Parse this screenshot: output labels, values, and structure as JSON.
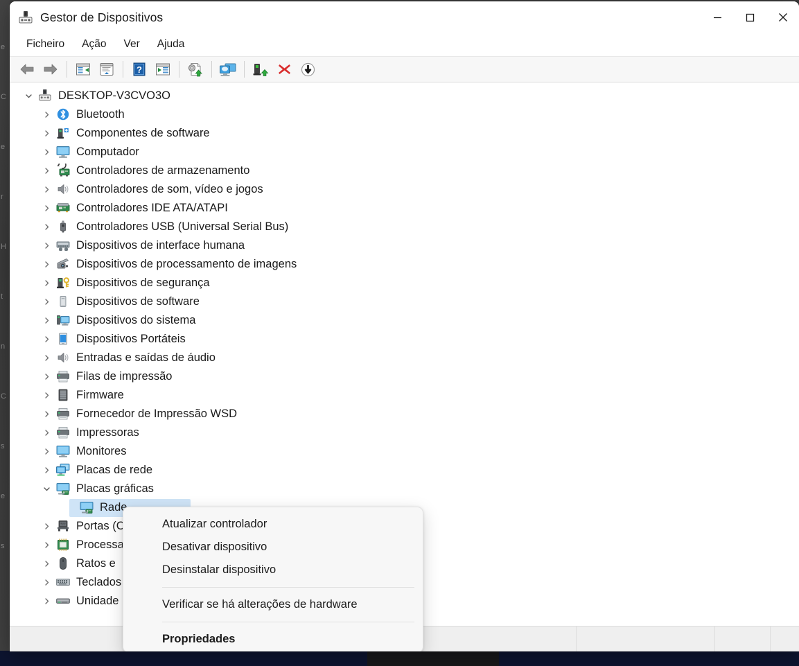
{
  "window": {
    "title": "Gestor de Dispositivos",
    "icon": "device-manager-icon",
    "controls": {
      "minimize": "—",
      "maximize": "☐",
      "close": "✕"
    }
  },
  "menubar": {
    "items": [
      {
        "label": "Ficheiro",
        "name": "menu-ficheiro"
      },
      {
        "label": "Ação",
        "name": "menu-acao"
      },
      {
        "label": "Ver",
        "name": "menu-ver"
      },
      {
        "label": "Ajuda",
        "name": "menu-ajuda"
      }
    ]
  },
  "toolbar": {
    "buttons": [
      {
        "name": "back-button",
        "icon": "back-arrow-icon"
      },
      {
        "name": "forward-button",
        "icon": "forward-arrow-icon"
      },
      {
        "sep": true
      },
      {
        "name": "show-hidden-devices-button",
        "icon": "properties-panel-icon"
      },
      {
        "name": "properties-button",
        "icon": "properties-window-icon"
      },
      {
        "sep": true
      },
      {
        "name": "help-button",
        "icon": "help-question-icon"
      },
      {
        "name": "view-details-button",
        "icon": "details-panel-icon"
      },
      {
        "sep": true
      },
      {
        "name": "update-driver-button",
        "icon": "update-driver-icon"
      },
      {
        "sep": true
      },
      {
        "name": "scan-hardware-changes-button",
        "icon": "scan-hardware-icon"
      },
      {
        "sep": true
      },
      {
        "name": "enable-device-button",
        "icon": "enable-device-icon"
      },
      {
        "name": "uninstall-device-button",
        "icon": "red-x-icon"
      },
      {
        "name": "disable-device-button",
        "icon": "down-arrow-circle-icon"
      }
    ]
  },
  "tree": {
    "root": {
      "label": "DESKTOP-V3CVO3O",
      "name": "tree-root-desktop",
      "expanded": true,
      "icon": "computer-root-icon"
    },
    "items": [
      {
        "label": "Bluetooth",
        "icon": "bluetooth-icon",
        "expanded": false,
        "depth": 1
      },
      {
        "label": "Componentes de software",
        "icon": "software-component-icon",
        "expanded": false,
        "depth": 1
      },
      {
        "label": "Computador",
        "icon": "computer-icon",
        "expanded": false,
        "depth": 1
      },
      {
        "label": "Controladores de armazenamento",
        "icon": "storage-controller-icon",
        "expanded": false,
        "depth": 1
      },
      {
        "label": "Controladores de som, vídeo e jogos",
        "icon": "sound-icon",
        "expanded": false,
        "depth": 1
      },
      {
        "label": "Controladores IDE ATA/ATAPI",
        "icon": "ide-controller-icon",
        "expanded": false,
        "depth": 1
      },
      {
        "label": "Controladores USB (Universal Serial Bus)",
        "icon": "usb-icon",
        "expanded": false,
        "depth": 1
      },
      {
        "label": "Dispositivos de interface humana",
        "icon": "hid-icon",
        "expanded": false,
        "depth": 1
      },
      {
        "label": "Dispositivos de processamento de imagens",
        "icon": "imaging-device-icon",
        "expanded": false,
        "depth": 1
      },
      {
        "label": "Dispositivos de segurança",
        "icon": "security-device-icon",
        "expanded": false,
        "depth": 1
      },
      {
        "label": "Dispositivos de software",
        "icon": "software-device-icon",
        "expanded": false,
        "depth": 1
      },
      {
        "label": "Dispositivos do sistema",
        "icon": "system-device-icon",
        "expanded": false,
        "depth": 1
      },
      {
        "label": "Dispositivos Portáteis",
        "icon": "portable-device-icon",
        "expanded": false,
        "depth": 1
      },
      {
        "label": "Entradas e saídas de áudio",
        "icon": "audio-io-icon",
        "expanded": false,
        "depth": 1
      },
      {
        "label": "Filas de impressão",
        "icon": "print-queue-icon",
        "expanded": false,
        "depth": 1
      },
      {
        "label": "Firmware",
        "icon": "firmware-icon",
        "expanded": false,
        "depth": 1
      },
      {
        "label": "Fornecedor de Impressão WSD",
        "icon": "wsd-print-provider-icon",
        "expanded": false,
        "depth": 1
      },
      {
        "label": "Impressoras",
        "icon": "printer-icon",
        "expanded": false,
        "depth": 1
      },
      {
        "label": "Monitores",
        "icon": "monitor-icon",
        "expanded": false,
        "depth": 1
      },
      {
        "label": "Placas de rede",
        "icon": "network-adapter-icon",
        "expanded": false,
        "depth": 1
      },
      {
        "label": "Placas gráficas",
        "icon": "display-adapter-icon",
        "expanded": true,
        "depth": 1
      },
      {
        "label": "Rade",
        "icon": "display-adapter-icon",
        "expanded": null,
        "depth": 2,
        "selected": true
      },
      {
        "label": "Portas (C",
        "icon": "port-icon",
        "expanded": false,
        "depth": 1
      },
      {
        "label": "Processa",
        "icon": "processor-icon",
        "expanded": false,
        "depth": 1
      },
      {
        "label": "Ratos e ",
        "icon": "mouse-icon",
        "expanded": false,
        "depth": 1
      },
      {
        "label": "Teclados",
        "icon": "keyboard-icon",
        "expanded": false,
        "depth": 1
      },
      {
        "label": "Unidade",
        "icon": "disk-drive-icon",
        "expanded": false,
        "depth": 1
      }
    ]
  },
  "context_menu": {
    "items": [
      {
        "label": "Atualizar controlador",
        "name": "ctx-update-driver",
        "bold": false
      },
      {
        "label": "Desativar dispositivo",
        "name": "ctx-disable-device",
        "bold": false
      },
      {
        "label": "Desinstalar dispositivo",
        "name": "ctx-uninstall-device",
        "bold": false
      },
      {
        "separator": true
      },
      {
        "label": "Verificar se há alterações de hardware",
        "name": "ctx-scan-hardware-changes",
        "bold": false
      },
      {
        "separator": true
      },
      {
        "label": "Propriedades",
        "name": "ctx-properties",
        "bold": true
      }
    ]
  },
  "statusbar": {
    "segments": [
      "",
      "",
      "",
      ""
    ]
  },
  "colors": {
    "selection": "#cfe4f7",
    "accent_blue": "#2f85c9",
    "toolbar_bg": "#f7f7f7",
    "window_bg": "#ffffff",
    "menu_bg": "#f7f7f7",
    "desktop_bg": "#3c3c3c",
    "taskbar_bg": "#0d1430",
    "error_red": "#d32f2f"
  }
}
